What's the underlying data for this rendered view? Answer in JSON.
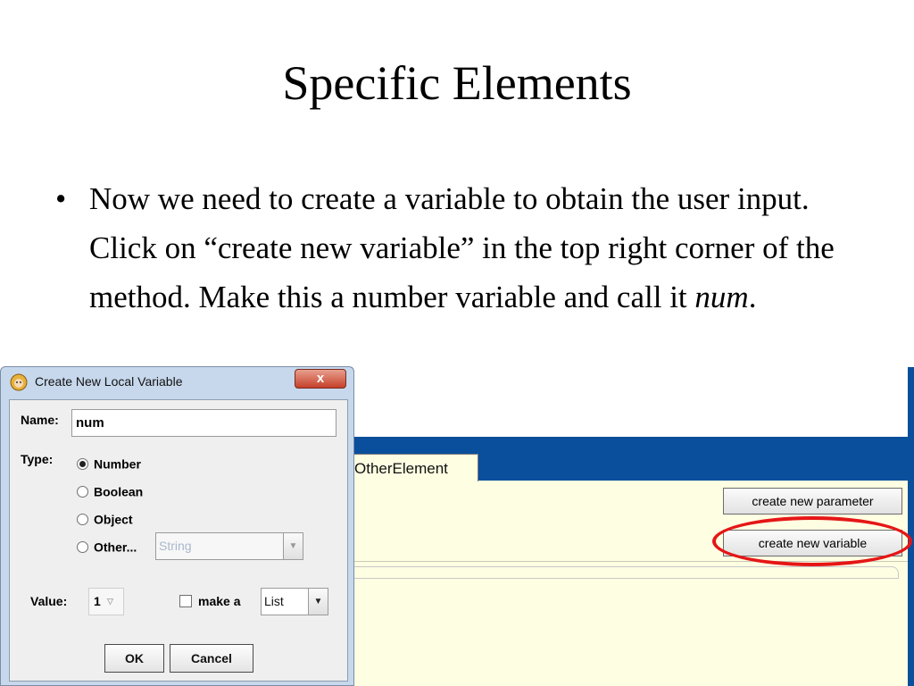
{
  "slide": {
    "title": "Specific Elements",
    "bullet_symbol": "•",
    "bullet_text": "Now we need to create a variable to obtain the user input. Click on “create new variable” in the top right corner of the method. Make this a number variable and call it ",
    "bullet_emphasis": "num",
    "bullet_end": "."
  },
  "app": {
    "tab_label": "OtherElement",
    "create_param_label": "create new parameter",
    "create_var_label": "create new variable",
    "highlight_color": "#e51616"
  },
  "dialog": {
    "title": "Create New Local Variable",
    "close_label": "x",
    "name_label": "Name:",
    "name_value": "num",
    "type_label": "Type:",
    "type_options": [
      "Number",
      "Boolean",
      "Object",
      "Other..."
    ],
    "selected_type": "Number",
    "other_placeholder": "String",
    "value_label": "Value:",
    "value_value": "1",
    "make_a_label": "make a",
    "make_a_value": "List",
    "ok_label": "OK",
    "cancel_label": "Cancel"
  }
}
